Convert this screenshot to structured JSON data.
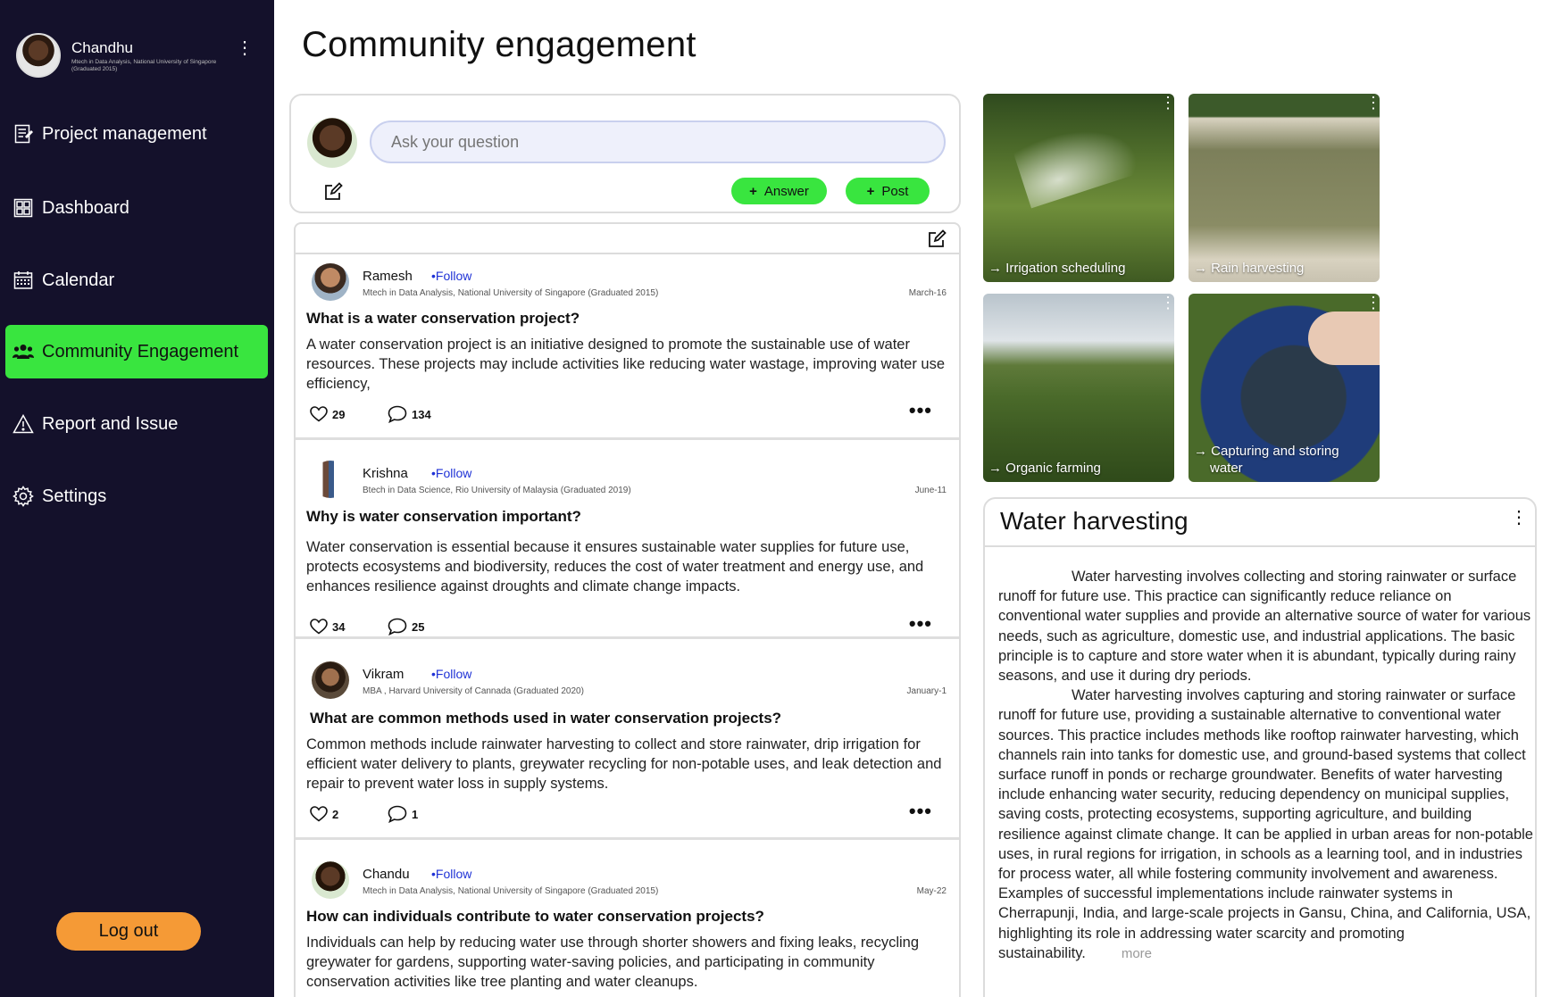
{
  "user": {
    "name": "Chandhu",
    "subtitle": "Mtech in Data Analysis, National University of Singapore (Graduated 2015)"
  },
  "nav": [
    {
      "label": "Project management",
      "icon": "document-icon"
    },
    {
      "label": "Dashboard",
      "icon": "grid-icon"
    },
    {
      "label": "Calendar",
      "icon": "calendar-icon"
    },
    {
      "label": "Community Engagement",
      "icon": "people-icon",
      "active": true
    },
    {
      "label": "Report and Issue",
      "icon": "warning-icon"
    },
    {
      "label": "Settings",
      "icon": "gear-icon"
    }
  ],
  "logout_label": "Log out",
  "page_title": "Community engagement",
  "ask": {
    "placeholder": "Ask your question",
    "answer_label": "Answer",
    "post_label": "Post"
  },
  "posts": [
    {
      "name": "Ramesh",
      "follow": "•Follow",
      "subtitle": "Mtech in Data Analysis, National University of Singapore (Graduated 2015)",
      "date": "March-16",
      "question": "What is a water conservation project?",
      "answer": "A water conservation project is an initiative designed to promote the sustainable use of water resources. These projects may include activities like reducing water wastage, improving water use efficiency,",
      "likes": "29",
      "comments": "134"
    },
    {
      "name": "Krishna",
      "follow": "•Follow",
      "subtitle": "Btech in Data Science,  Rio University of Malaysia (Graduated 2019)",
      "date": "June-11",
      "question": "Why is water conservation important?",
      "answer": "Water conservation is essential because it ensures sustainable water supplies for future use, protects ecosystems and biodiversity, reduces the cost of water treatment and energy use, and enhances resilience against droughts and climate change impacts.",
      "likes": "34",
      "comments": "25"
    },
    {
      "name": "Vikram",
      "follow": "•Follow",
      "subtitle": "MBA , Harvard University of Cannada (Graduated 2020)",
      "date": "January-1",
      "question": "What are common methods used in water conservation projects?",
      "answer": "Common methods include rainwater harvesting to collect and store rainwater, drip irrigation for efficient water delivery to plants, greywater recycling for non-potable uses, and leak detection and repair to prevent water loss in supply systems.",
      "likes": "2",
      "comments": "1"
    },
    {
      "name": "Chandu",
      "follow": "•Follow",
      "subtitle": "Mtech in Data Analysis, National University of Singapore (Graduated 2015)",
      "date": "May-22",
      "question": "How can individuals contribute to water conservation projects?",
      "answer": "Individuals can help by reducing water use through shorter showers and fixing leaks, recycling greywater for gardens, supporting water-saving policies, and participating in community conservation activities like tree planting and water cleanups."
    }
  ],
  "tiles": [
    {
      "label": "Irrigation scheduling"
    },
    {
      "label": "Rain harvesting"
    },
    {
      "label": "Organic farming"
    },
    {
      "label": "Capturing and storing water"
    }
  ],
  "article": {
    "title": "Water harvesting",
    "para1": "Water harvesting involves collecting and storing rainwater or surface runoff for future use. This practice can significantly reduce reliance on conventional water supplies and provide an alternative source of water for various needs, such as agriculture, domestic use, and industrial applications. The basic principle is to capture and store water when it is abundant, typically during rainy seasons, and use it during dry periods.",
    "para2": "Water harvesting involves capturing and storing rainwater or surface runoff for future use, providing a sustainable alternative to conventional water sources. This practice includes methods like rooftop rainwater harvesting, which channels rain into tanks for domestic use, and ground-based systems that collect surface runoff in ponds or recharge groundwater. Benefits of water harvesting include enhancing water security, reducing dependency on municipal supplies, saving costs, protecting ecosystems, supporting agriculture, and building resilience against climate change. It can be applied in urban areas for non-potable uses, in rural regions for irrigation, in schools as a learning tool, and in industries for process water, all while fostering community involvement and awareness. Examples of successful implementations include rainwater systems in Cherrapunji, India, and large-scale projects in Gansu, China, and California, USA, highlighting its role in addressing water scarcity and promoting sustainability.",
    "more_label": "more"
  },
  "colors": {
    "sidebar_bg": "#14112b",
    "accent_green": "#39e53f",
    "logout_orange": "#f59a36",
    "follow_blue": "#1f32d6"
  }
}
